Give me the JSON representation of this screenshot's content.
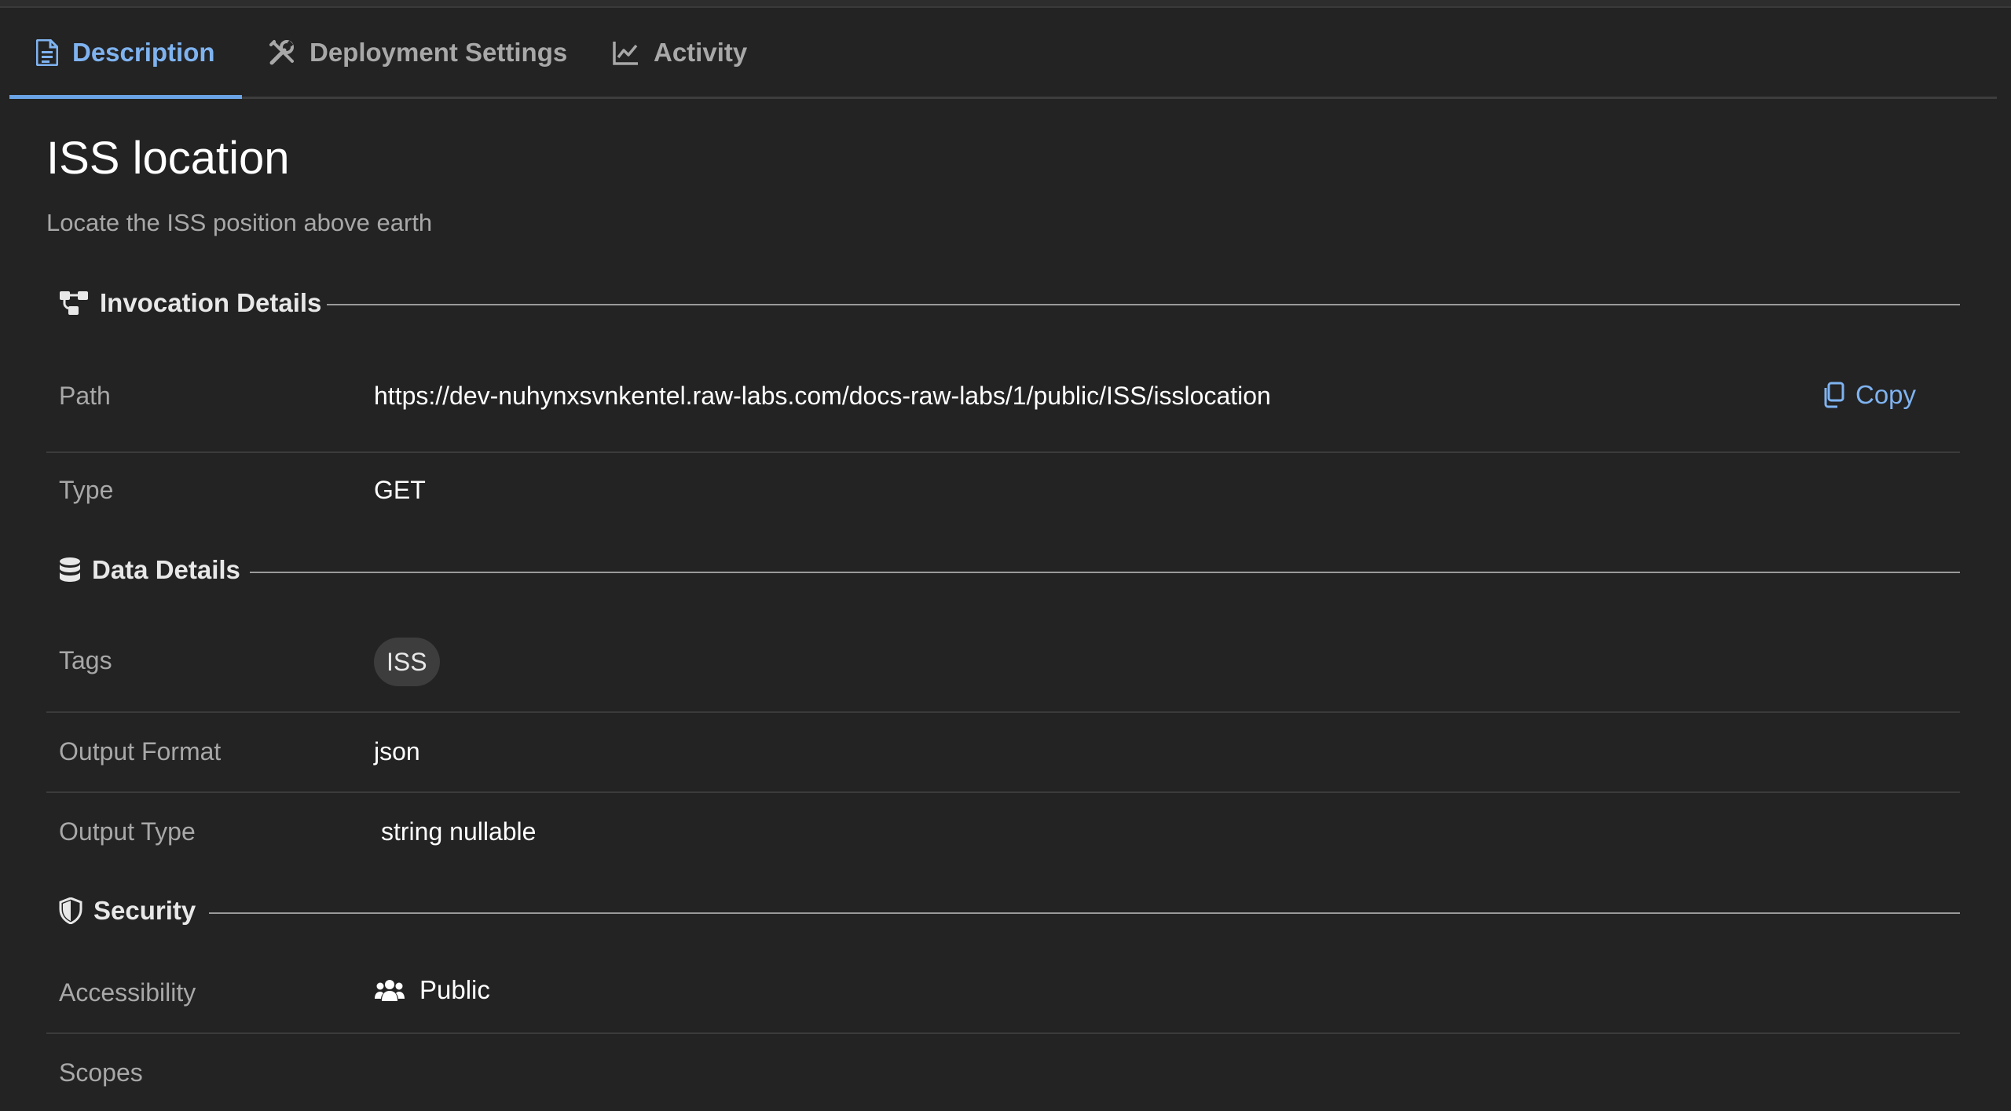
{
  "tabs": [
    {
      "label": "Description",
      "icon": "document-icon",
      "active": true
    },
    {
      "label": "Deployment Settings",
      "icon": "tools-icon",
      "active": false
    },
    {
      "label": "Activity",
      "icon": "line-chart-icon",
      "active": false
    }
  ],
  "header": {
    "title": "ISS location",
    "description": "Locate the ISS position above earth"
  },
  "invocation": {
    "heading": "Invocation Details",
    "path_label": "Path",
    "path_value": "https://dev-nuhynxsvnkentel.raw-labs.com/docs-raw-labs/1/public/ISS/isslocation",
    "copy_label": "Copy",
    "type_label": "Type",
    "type_value": "GET"
  },
  "data_details": {
    "heading": "Data Details",
    "tags_label": "Tags",
    "tags": [
      "ISS"
    ],
    "output_format_label": "Output Format",
    "output_format_value": "json",
    "output_type_label": "Output Type",
    "output_type_value": "string nullable"
  },
  "security": {
    "heading": "Security",
    "accessibility_label": "Accessibility",
    "accessibility_value": "Public",
    "scopes_label": "Scopes"
  },
  "colors": {
    "background": "#232323",
    "accent": "#7fb3f0",
    "muted_text": "#a8a8a8",
    "divider": "#3b3b3b"
  }
}
